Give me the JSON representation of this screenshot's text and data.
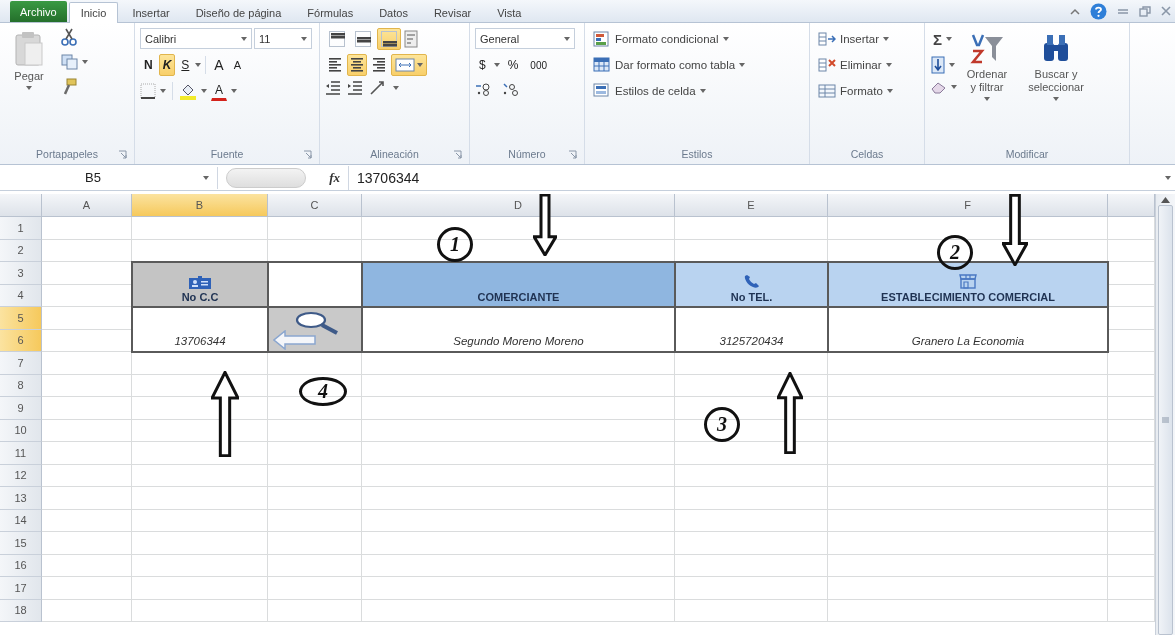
{
  "ribbon_tabs": [
    {
      "label": "Archivo",
      "kind": "file",
      "selected": false
    },
    {
      "label": "Inicio",
      "kind": "tab",
      "selected": true
    },
    {
      "label": "Insertar",
      "kind": "tab",
      "selected": false
    },
    {
      "label": "Diseño de página",
      "kind": "tab",
      "selected": false
    },
    {
      "label": "Fórmulas",
      "kind": "tab",
      "selected": false
    },
    {
      "label": "Datos",
      "kind": "tab",
      "selected": false
    },
    {
      "label": "Revisar",
      "kind": "tab",
      "selected": false
    },
    {
      "label": "Vista",
      "kind": "tab",
      "selected": false
    }
  ],
  "ribbon": {
    "clipboard": {
      "title": "Portapapeles",
      "paste": "Pegar"
    },
    "font": {
      "title": "Fuente",
      "font_name": "Calibri",
      "font_size": "11",
      "grow": "A",
      "shrink": "A",
      "font_color": "A",
      "styles": [
        {
          "label": "N",
          "kind": "bold",
          "on": false
        },
        {
          "label": "K",
          "kind": "italic",
          "on": true
        },
        {
          "label": "S",
          "kind": "underline",
          "on": false
        }
      ]
    },
    "alignment": {
      "title": "Alineación",
      "vertical": [
        {
          "kind": "top",
          "on": false
        },
        {
          "kind": "middle",
          "on": false
        },
        {
          "kind": "bottom",
          "on": true
        }
      ],
      "horizontal": [
        {
          "kind": "left",
          "on": false
        },
        {
          "kind": "center",
          "on": true
        },
        {
          "kind": "right",
          "on": false
        }
      ],
      "merge": {
        "on": true
      }
    },
    "number": {
      "title": "Número",
      "format": "General",
      "currency": "$",
      "percent": "%",
      "thousands": "000"
    },
    "styles": {
      "title": "Estilos",
      "items": [
        "Formato condicional",
        "Dar formato como tabla",
        "Estilos de celda"
      ]
    },
    "cells": {
      "title": "Celdas",
      "items": [
        "Insertar",
        "Eliminar",
        "Formato"
      ]
    },
    "editing": {
      "title": "Modificar",
      "sum": "Σ",
      "sort": "Ordenar y filtrar",
      "find": "Buscar y seleccionar"
    }
  },
  "formula_bar": {
    "name_box": "B5",
    "function_label": "fx",
    "value": "13706344"
  },
  "sheet": {
    "columns": [
      {
        "label": "A",
        "selected": false
      },
      {
        "label": "B",
        "selected": true
      },
      {
        "label": "C",
        "selected": false
      },
      {
        "label": "D",
        "selected": false
      },
      {
        "label": "E",
        "selected": false
      },
      {
        "label": "F",
        "selected": false
      }
    ],
    "rows": [
      {
        "label": "1",
        "selected": false
      },
      {
        "label": "2",
        "selected": false
      },
      {
        "label": "3",
        "selected": false
      },
      {
        "label": "4",
        "selected": false
      },
      {
        "label": "5",
        "selected": true
      },
      {
        "label": "6",
        "selected": true
      },
      {
        "label": "7",
        "selected": false
      },
      {
        "label": "8",
        "selected": false
      },
      {
        "label": "9",
        "selected": false
      },
      {
        "label": "10",
        "selected": false
      },
      {
        "label": "11",
        "selected": false
      },
      {
        "label": "12",
        "selected": false
      },
      {
        "label": "13",
        "selected": false
      },
      {
        "label": "14",
        "selected": false
      },
      {
        "label": "15",
        "selected": false
      },
      {
        "label": "16",
        "selected": false
      },
      {
        "label": "17",
        "selected": false
      },
      {
        "label": "18",
        "selected": false
      }
    ]
  },
  "table": {
    "headers": [
      {
        "kind": "id",
        "text": "No C.C",
        "color": "#c4c4c4"
      },
      {
        "kind": "blank",
        "color": "#ffffff"
      },
      {
        "kind": "name",
        "text": "COMERCIANTE",
        "color": "#8fb6e0"
      },
      {
        "kind": "phone",
        "text": "No TEL.",
        "color": "#b9d3f0"
      },
      {
        "kind": "shop",
        "text": "ESTABLECIMIENTO COMERCIAL",
        "color": "#b9d3f0"
      }
    ],
    "row": [
      {
        "kind": "text",
        "text": "13706344"
      },
      {
        "kind": "search"
      },
      {
        "kind": "text",
        "text": "Segundo Moreno Moreno"
      },
      {
        "kind": "text",
        "text": "3125720434"
      },
      {
        "kind": "text",
        "text": "Granero La Economia"
      }
    ]
  },
  "annotations": {
    "numbers": [
      "1",
      "2",
      "3",
      "4"
    ],
    "arrows": [
      {
        "kind": "down"
      },
      {
        "kind": "down"
      },
      {
        "kind": "up"
      },
      {
        "kind": "up"
      }
    ]
  }
}
